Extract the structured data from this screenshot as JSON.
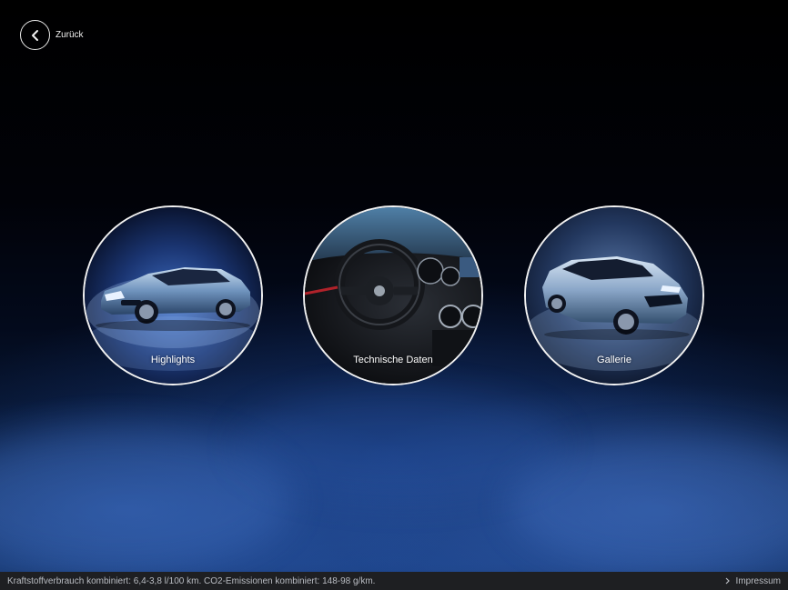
{
  "nav": {
    "back_label": "Zurück",
    "back_icon": "chevron-left-icon"
  },
  "tiles": [
    {
      "label": "Highlights",
      "image": "silver-hatchback-front-view"
    },
    {
      "label": "Technische Daten",
      "image": "car-interior-steering-wheel"
    },
    {
      "label": "Gallerie",
      "image": "silver-hatchback-front-right-view"
    }
  ],
  "footer": {
    "consumption_text": "Kraftstoffverbrauch kombiniert: 6,4-3,8 l/100 km. CO2-Emissionen kombiniert: 148-98 g/km.",
    "impressum_label": "Impressum",
    "impressum_icon": "chevron-right-icon"
  },
  "colors": {
    "background": "#000000",
    "fog_blue": "#1c4a8f",
    "footer_bg": "#1e1f22",
    "footer_text": "#b9bcc2",
    "ring": "#f2f2f2"
  }
}
